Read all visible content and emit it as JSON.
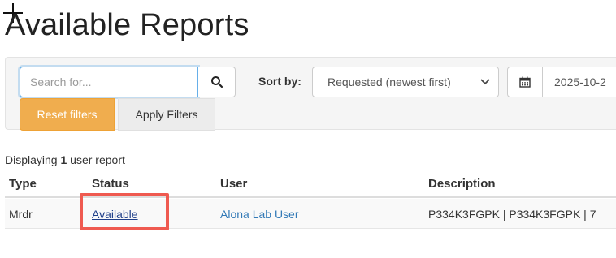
{
  "page": {
    "title": "Available Reports"
  },
  "filters": {
    "search_placeholder": "Search for...",
    "sort_label": "Sort by:",
    "sort_value": "Requested (newest first)",
    "date_value": "2025-10-2",
    "reset_label": "Reset filters",
    "apply_label": "Apply Filters"
  },
  "results": {
    "prefix": "Displaying",
    "count": "1",
    "suffix": "user report"
  },
  "table": {
    "columns": [
      "Type",
      "Status",
      "User",
      "Description"
    ],
    "rows": [
      {
        "type": "Mrdr",
        "status": "Available",
        "user": "Alona Lab User",
        "description": "P334K3FGPK | P334K3FGPK | 7"
      }
    ]
  },
  "colors": {
    "accent_orange": "#f0ad4e",
    "link_blue": "#337ab7",
    "highlight_red": "#ef5a50"
  },
  "icons": {
    "search": "search-icon",
    "calendar": "calendar-icon",
    "sort_chevron": "chevron-down-icon"
  }
}
